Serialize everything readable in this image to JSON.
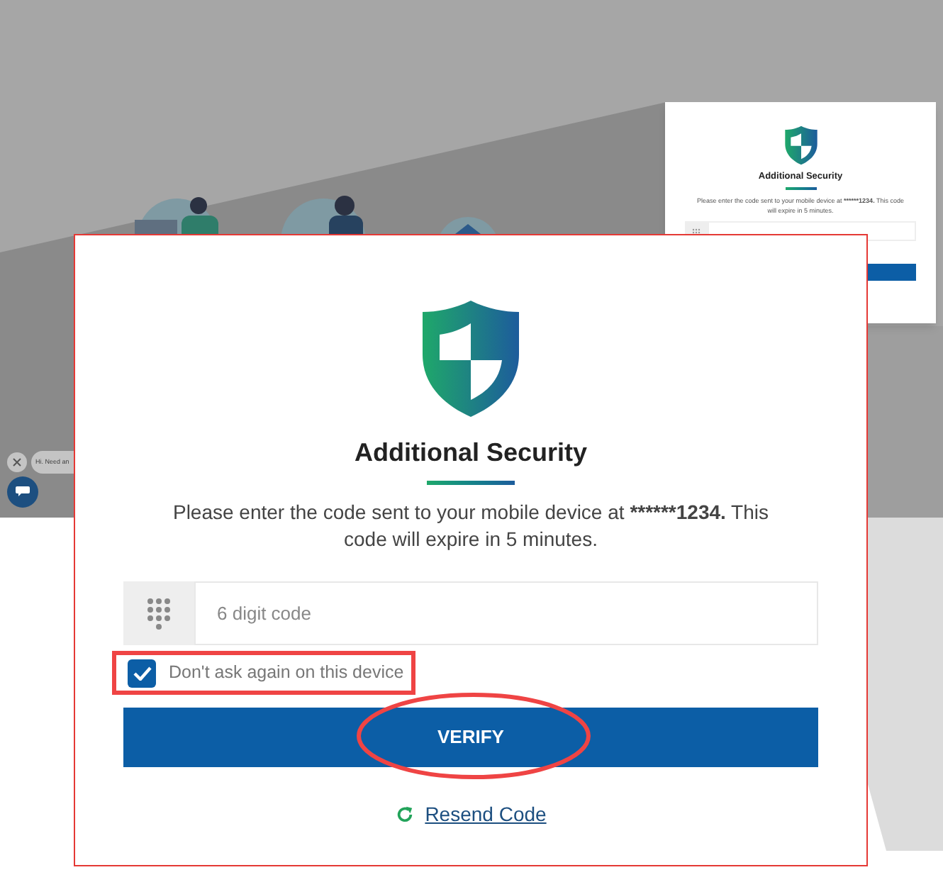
{
  "chat": {
    "message": "Hi. Need an"
  },
  "preview": {
    "title": "Additional Security",
    "message": {
      "before": "Please enter the code sent to your mobile device at ",
      "bold": "******1234.",
      "after": " This code will expire in 5 minutes."
    }
  },
  "dialog": {
    "title": "Additional Security",
    "message": {
      "before": "Please enter the code sent to your mobile device at ",
      "bold": "******1234.",
      "after": " This code will expire in 5 minutes."
    },
    "code_field": {
      "placeholder": "6 digit code"
    },
    "remember": {
      "label": "Don't ask again on this device",
      "checked": true
    },
    "verify_button": "VERIFY",
    "resend_link": "Resend Code"
  }
}
